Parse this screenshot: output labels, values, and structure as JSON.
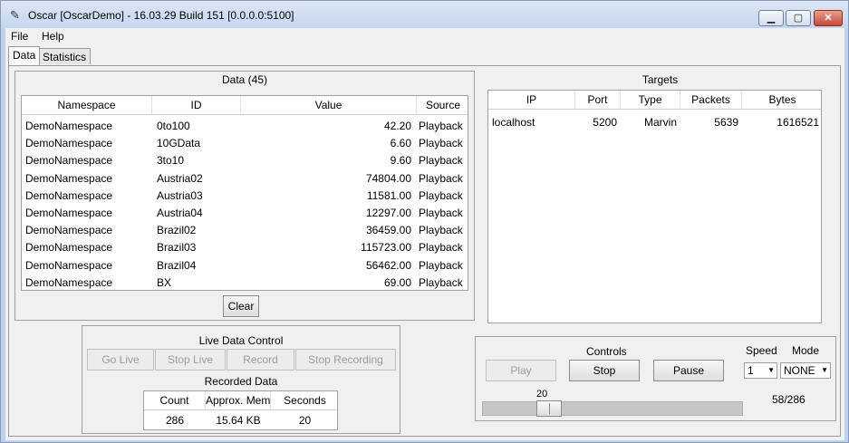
{
  "window": {
    "title": "Oscar [OscarDemo] - 16.03.29 Build 151 [0.0.0.0:5100]",
    "icon": "feather-icon",
    "min_glyph": "▁",
    "max_glyph": "▢",
    "close_glyph": "✕"
  },
  "menu": {
    "file": "File",
    "help": "Help"
  },
  "tabs": [
    {
      "label": "Data",
      "active": true
    },
    {
      "label": "Statistics",
      "active": false
    }
  ],
  "data_panel": {
    "title": "Data (45)",
    "columns": [
      "Namespace",
      "ID",
      "Value",
      "Source"
    ],
    "rows": [
      [
        "DemoNamespace",
        "0to100",
        "42.20",
        "Playback"
      ],
      [
        "DemoNamespace",
        "10GData",
        "6.60",
        "Playback"
      ],
      [
        "DemoNamespace",
        "3to10",
        "9.60",
        "Playback"
      ],
      [
        "DemoNamespace",
        "Austria02",
        "74804.00",
        "Playback"
      ],
      [
        "DemoNamespace",
        "Austria03",
        "11581.00",
        "Playback"
      ],
      [
        "DemoNamespace",
        "Austria04",
        "12297.00",
        "Playback"
      ],
      [
        "DemoNamespace",
        "Brazil02",
        "36459.00",
        "Playback"
      ],
      [
        "DemoNamespace",
        "Brazil03",
        "115723.00",
        "Playback"
      ],
      [
        "DemoNamespace",
        "Brazil04",
        "56462.00",
        "Playback"
      ],
      [
        "DemoNamespace",
        "BX",
        "69.00",
        "Playback"
      ]
    ],
    "clear_label": "Clear"
  },
  "targets_panel": {
    "title": "Targets",
    "columns": [
      "IP",
      "Port",
      "Type",
      "Packets",
      "Bytes"
    ],
    "rows": [
      [
        "localhost",
        "5200",
        "Marvin",
        "5639",
        "1616521"
      ]
    ]
  },
  "live_control": {
    "title": "Live Data Control",
    "go_live": "Go Live",
    "stop_live": "Stop Live",
    "record": "Record",
    "stop_recording": "Stop Recording",
    "recorded_title": "Recorded Data",
    "rec_columns": [
      "Count",
      "Approx. Mem",
      "Seconds"
    ],
    "rec_values": [
      "286",
      "15.64 KB",
      "20"
    ]
  },
  "controls": {
    "title": "Controls",
    "play": "Play",
    "stop": "Stop",
    "pause": "Pause",
    "speed_label": "Speed",
    "mode_label": "Mode",
    "speed_value": "1",
    "mode_value": "NONE",
    "slider_value_label": "20",
    "slider_position": 0.23,
    "progress": "58/286"
  }
}
